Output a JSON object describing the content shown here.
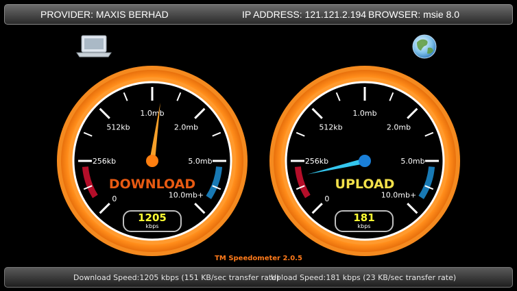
{
  "header": {
    "provider": "PROVIDER: MAXIS BERHAD",
    "ip": "IP ADDRESS: 121.121.2.194",
    "browser": "BROWSER: msie 8.0"
  },
  "connection": {
    "from_icon": "laptop-icon",
    "to_icon": "globe-icon"
  },
  "gauge_scale": [
    "0",
    "256kb",
    "512kb",
    "1.0mb",
    "2.0mb",
    "5.0mb",
    "10.0mb+"
  ],
  "gauges": [
    {
      "label": "DOWNLOAD",
      "value": "1205",
      "unit": "kbps",
      "label_color": "#e85a12",
      "needle_color": "#f7a02a",
      "hub_color": "#ff7f10"
    },
    {
      "label": "UPLOAD",
      "value": "181",
      "unit": "kbps",
      "label_color": "#f2e04a",
      "needle_color": "#34c6ee",
      "hub_color": "#1a7fd8"
    }
  ],
  "version": "TM Speedometer 2.0.5",
  "footer": {
    "download": "Download Speed:1205 kbps (151 KB/sec transfer rate)",
    "upload": "Upload Speed:181 kbps (23 KB/sec transfer rate)"
  }
}
